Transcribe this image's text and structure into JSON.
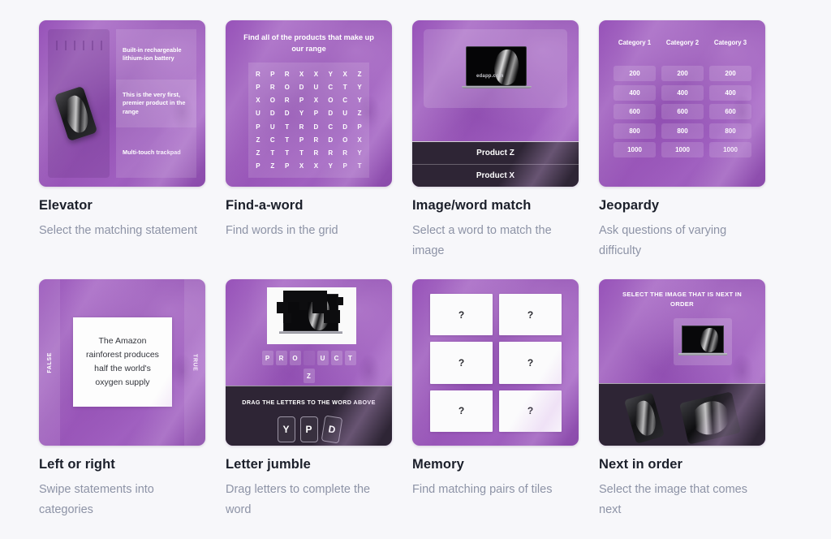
{
  "page": {
    "background": "#f7f7fa",
    "accent_purple": "#8b4aad",
    "dark_panel": "#2e2535"
  },
  "cards": [
    {
      "id": "elevator",
      "title": "Elevator",
      "description": "Select the matching statement",
      "statements": [
        "Built-in rechargeable lithium-ion battery",
        "This is the very first, premier product in the range",
        "Multi-touch trackpad"
      ]
    },
    {
      "id": "find-a-word",
      "title": "Find-a-word",
      "description": "Find words in the grid",
      "prompt": "Find all of the products that make up our range",
      "letter_grid": [
        [
          "R",
          "P",
          "R",
          "X",
          "X",
          "Y",
          "X",
          "Z"
        ],
        [
          "P",
          "R",
          "O",
          "D",
          "U",
          "C",
          "T",
          "Y"
        ],
        [
          "X",
          "O",
          "R",
          "P",
          "X",
          "O",
          "C",
          "Y"
        ],
        [
          "U",
          "D",
          "D",
          "Y",
          "P",
          "D",
          "U",
          "Z"
        ],
        [
          "P",
          "U",
          "T",
          "R",
          "D",
          "C",
          "D",
          "P"
        ],
        [
          "Z",
          "C",
          "T",
          "P",
          "R",
          "D",
          "O",
          "X"
        ],
        [
          "Z",
          "T",
          "T",
          "T",
          "R",
          "R",
          "R",
          "Y"
        ],
        [
          "P",
          "Z",
          "P",
          "X",
          "X",
          "Y",
          "P",
          "T"
        ]
      ]
    },
    {
      "id": "image-word-match",
      "title": "Image/word match",
      "description": "Select a word to match the image",
      "image_brand": "edapp.com",
      "options": [
        "Product Z",
        "Product X"
      ]
    },
    {
      "id": "jeopardy",
      "title": "Jeopardy",
      "description": "Ask questions of varying difficulty",
      "categories": [
        "Category 1",
        "Category 2",
        "Category 3"
      ],
      "values": [
        "200",
        "400",
        "600",
        "800",
        "1000"
      ]
    },
    {
      "id": "left-or-right",
      "title": "Left or right",
      "description": "Swipe statements into categories",
      "left_label": "FALSE",
      "right_label": "TRUE",
      "statement": "The Amazon rainforest produces half the world's oxygen supply"
    },
    {
      "id": "letter-jumble",
      "title": "Letter jumble",
      "description": "Drag letters to complete the word",
      "word_slots": [
        "P",
        "R",
        "O",
        "",
        "U",
        "C",
        "T"
      ],
      "extra_slot": "Z",
      "hint": "DRAG THE LETTERS TO THE WORD ABOVE",
      "tiles": [
        "Y",
        "P",
        "D"
      ]
    },
    {
      "id": "memory",
      "title": "Memory",
      "description": "Find matching pairs of tiles",
      "tiles": [
        "?",
        "?",
        "?",
        "?",
        "?",
        "?"
      ]
    },
    {
      "id": "next-in-order",
      "title": "Next in order",
      "description": "Select the image that comes next",
      "prompt": "SELECT THE IMAGE THAT IS NEXT IN ORDER"
    }
  ]
}
